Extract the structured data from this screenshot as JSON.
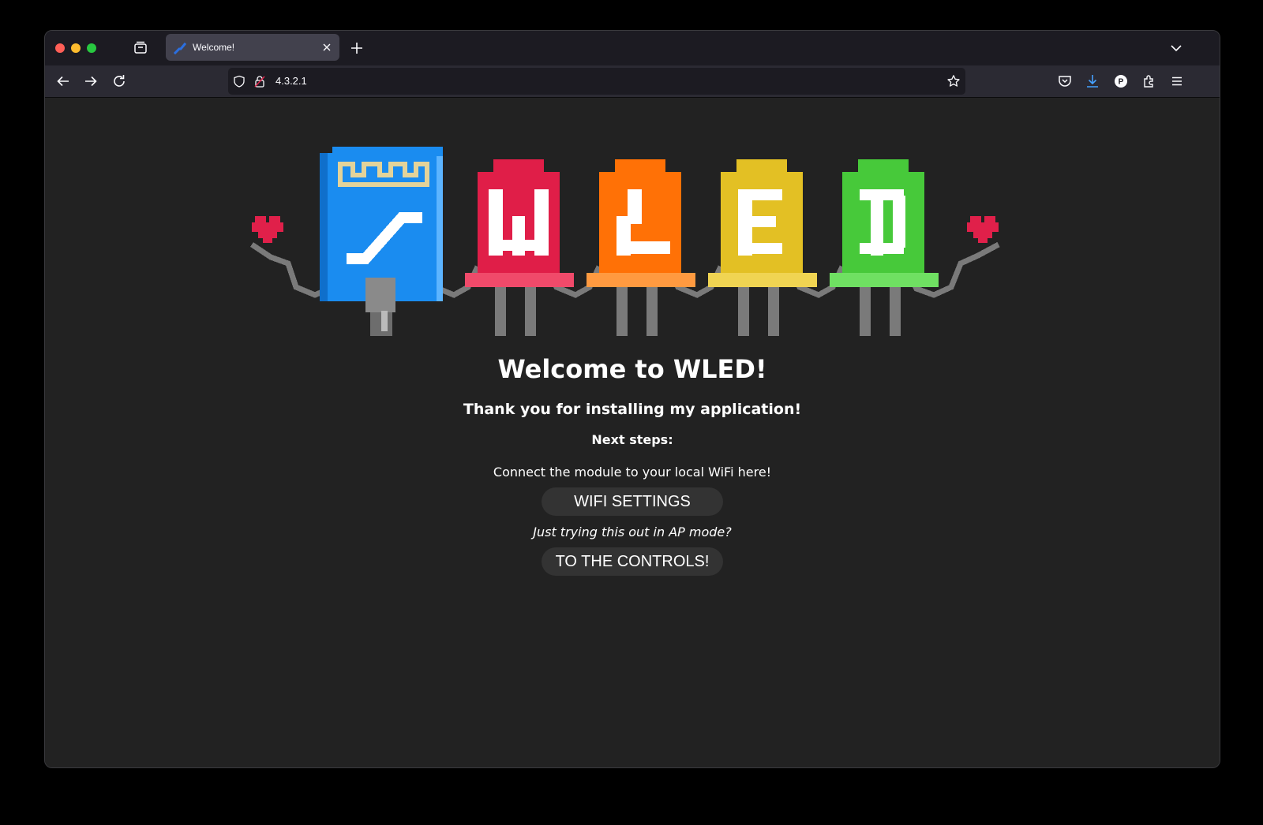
{
  "browser": {
    "tab": {
      "title": "Welcome!",
      "favicon": "wled-icon"
    },
    "url": "4.3.2.1",
    "icons": {
      "tab_list": "tab-list-icon",
      "new_tab": "plus-icon",
      "list_all_tabs": "chevron-down-icon",
      "back": "back-arrow-icon",
      "forward": "forward-arrow-icon",
      "reload": "reload-icon",
      "shield": "shield-icon",
      "lock": "lock-icon",
      "bookmark": "star-icon",
      "pocket": "pocket-icon",
      "downloads": "download-icon",
      "account": "account-icon",
      "extensions": "extensions-icon",
      "menu": "hamburger-menu-icon"
    },
    "accent_download": "#45a1ff"
  },
  "page": {
    "heading": "Welcome to WLED!",
    "thanks": "Thank you for installing my application!",
    "next_steps": "Next steps:",
    "connect_text": "Connect the module to your local WiFi here!",
    "wifi_button": "WIFI SETTINGS",
    "ap_mode_text": "Just trying this out in AP mode?",
    "controls_button": "TO THE CONTROLS!",
    "logo": {
      "name": "wled-pixel-logo",
      "letters": [
        "W",
        "L",
        "E",
        "D"
      ],
      "colors": {
        "chip": "#1a8cf0",
        "red": "#e01e48",
        "orange": "#ff7106",
        "yellow": "#e3c024",
        "green": "#47c93a",
        "heart": "#e0204a"
      }
    }
  }
}
